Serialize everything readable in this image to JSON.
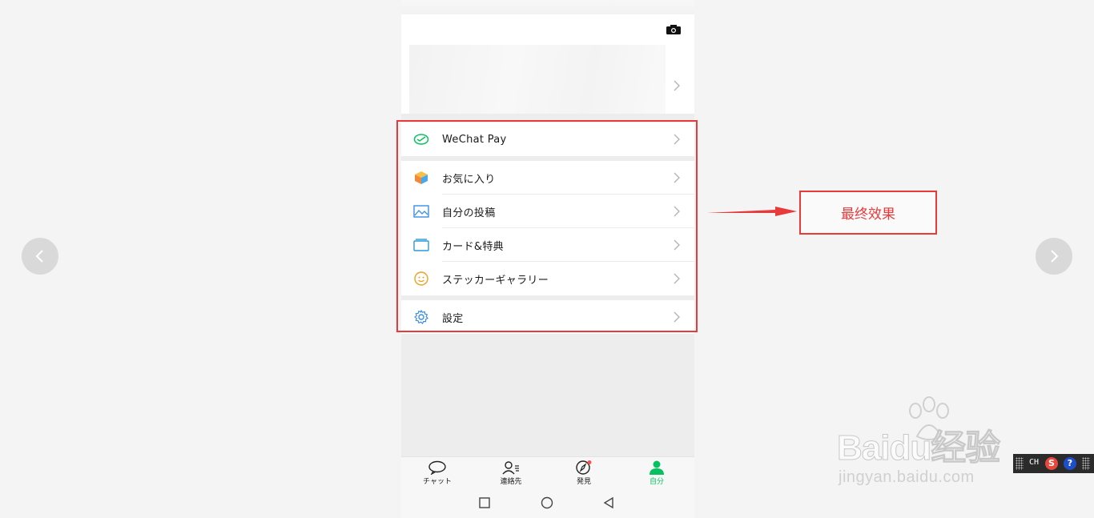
{
  "menu": {
    "group1": [
      {
        "label": "WeChat Pay",
        "icon": "wechat-pay-icon",
        "color": "#07c160"
      }
    ],
    "group2": [
      {
        "label": "お気に入り",
        "icon": "favorites-cube-icon",
        "color": "#f0a020"
      },
      {
        "label": "自分の投稿",
        "icon": "moments-image-icon",
        "color": "#3a8ee6"
      },
      {
        "label": "カード&特典",
        "icon": "card-icon",
        "color": "#2a9ad6"
      },
      {
        "label": "ステッカーギャラリー",
        "icon": "sticker-smile-icon",
        "color": "#f0a020"
      }
    ],
    "group3": [
      {
        "label": "設定",
        "icon": "settings-gear-icon",
        "color": "#3a8ee6"
      }
    ]
  },
  "tabbar": {
    "tabs": [
      {
        "label": "チャット",
        "icon": "chat-bubble-icon"
      },
      {
        "label": "連絡先",
        "icon": "contacts-icon"
      },
      {
        "label": "発見",
        "icon": "discover-compass-icon",
        "badge": true
      },
      {
        "label": "自分",
        "icon": "me-person-icon",
        "active": true
      }
    ],
    "active_color": "#07c160"
  },
  "annotation": {
    "callout_text": "最终效果",
    "color": "#e8393b"
  },
  "watermark": {
    "brand": "Baidu经验",
    "url": "jingyan.baidu.com"
  },
  "ime": {
    "mode": "CH",
    "s_label": "S",
    "help_label": "?"
  }
}
